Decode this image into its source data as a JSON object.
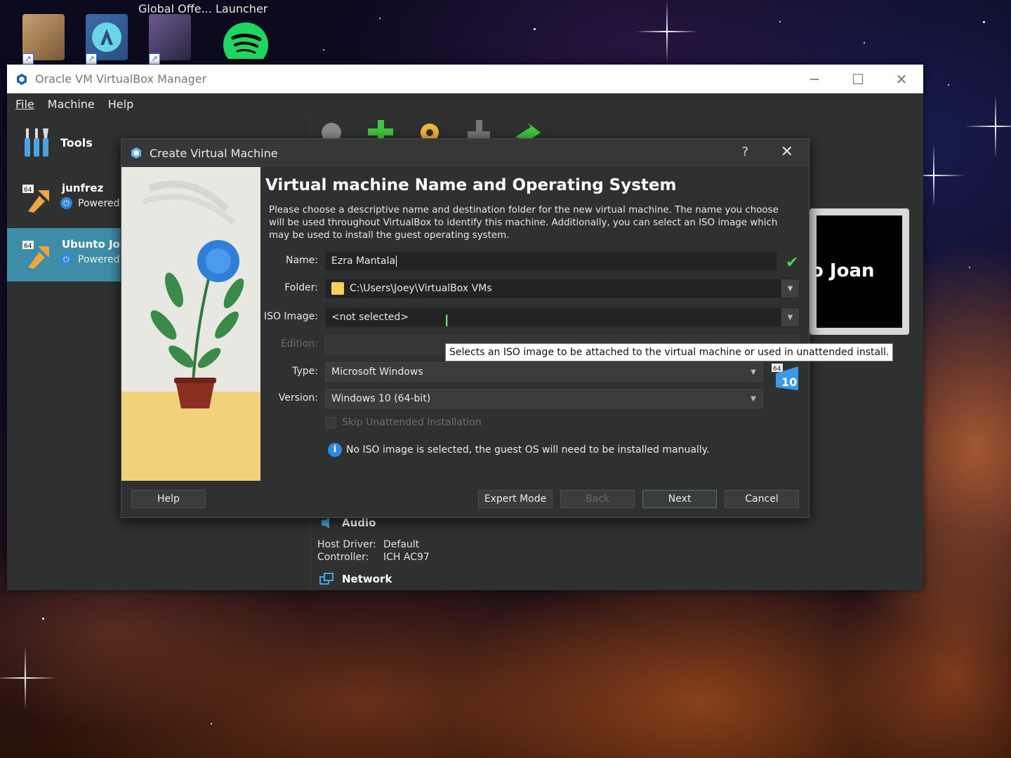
{
  "desktop": {
    "labels": [
      "Global Offe...",
      "Launcher"
    ]
  },
  "window": {
    "title": "Oracle VM VirtualBox Manager",
    "controls": {
      "minimize": "─",
      "maximize": "☐",
      "close": "✕"
    }
  },
  "menu": {
    "file": "File",
    "machine": "Machine",
    "help": "Help"
  },
  "sidebar": {
    "tools_label": "Tools",
    "vms": [
      {
        "name": "junfrez",
        "state": "Powered"
      },
      {
        "name": "Ubunto Joa",
        "state": "Powered"
      }
    ]
  },
  "preview": {
    "text": "o Joan"
  },
  "details": {
    "audio": {
      "title": "Audio",
      "host_driver_label": "Host Driver:",
      "host_driver_value": "Default",
      "controller_label": "Controller:",
      "controller_value": "ICH AC97"
    },
    "network": {
      "title": "Network"
    }
  },
  "dialog": {
    "title": "Create Virtual Machine",
    "help_glyph": "?",
    "close_glyph": "✕",
    "heading": "Virtual machine Name and Operating System",
    "description": "Please choose a descriptive name and destination folder for the new virtual machine. The name you choose will be used throughout VirtualBox to identify this machine. Additionally, you can select an ISO image which may be used to install the guest operating system.",
    "fields": {
      "name_label": "Name:",
      "name_value": "Ezra Mantala",
      "folder_label": "Folder:",
      "folder_value": "C:\\Users\\Joey\\VirtualBox VMs",
      "iso_label": "ISO Image:",
      "iso_value": "<not selected>",
      "edition_label": "Edition:",
      "edition_value": "",
      "type_label": "Type:",
      "type_value": "Microsoft Windows",
      "version_label": "Version:",
      "version_value": "Windows 10 (64-bit)"
    },
    "tooltip": "Selects an ISO image to be attached to the virtual machine or used in unattended install.",
    "os_badge": {
      "top": "64",
      "bottom": "10"
    },
    "skip_unattended": {
      "label": "Skip Unattended Installation",
      "checked": false,
      "enabled": false
    },
    "info_text": "No ISO image is selected, the guest OS will need to be installed manually.",
    "buttons": {
      "help": "Help",
      "expert": "Expert Mode",
      "back": "Back",
      "next": "Next",
      "cancel": "Cancel"
    }
  },
  "colors": {
    "selection": "#3d8da7",
    "accent_check": "#4bd04b",
    "info_blue": "#2b8be0"
  }
}
